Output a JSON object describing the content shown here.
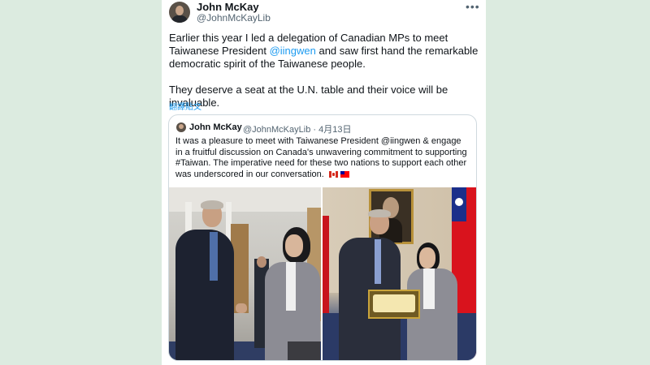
{
  "tweet": {
    "author_name": "John McKay",
    "author_handle": "@JohnMcKayLib",
    "more_icon": "more-icon",
    "paragraph1_before": "Earlier this year I led a delegation of Canadian MPs to meet Taiwanese President ",
    "paragraph1_mention": "@iingwen",
    "paragraph1_after": " and saw first hand the remarkable democratic spirit of the Taiwanese people.",
    "paragraph2": "They deserve a seat at the U.N. table and their voice will be invaluable.",
    "translate_label": "翻譯貼文"
  },
  "quoted": {
    "author_name": "John McKay",
    "author_handle": "@JohnMcKayLib",
    "date": "· 4月13日",
    "text": "It was a pleasure to meet with Taiwanese President @iingwen & engage in a fruitful discussion on Canada's unwavering commitment to supporting #Taiwan. The imperative need for these two nations to support each other was underscored in our conversation.",
    "flags": [
      "canada-flag-icon",
      "taiwan-flag-icon"
    ]
  },
  "colors": {
    "background": "#dcebe0",
    "link": "#1d9bf0",
    "text": "#0f1419",
    "secondary": "#536471"
  }
}
